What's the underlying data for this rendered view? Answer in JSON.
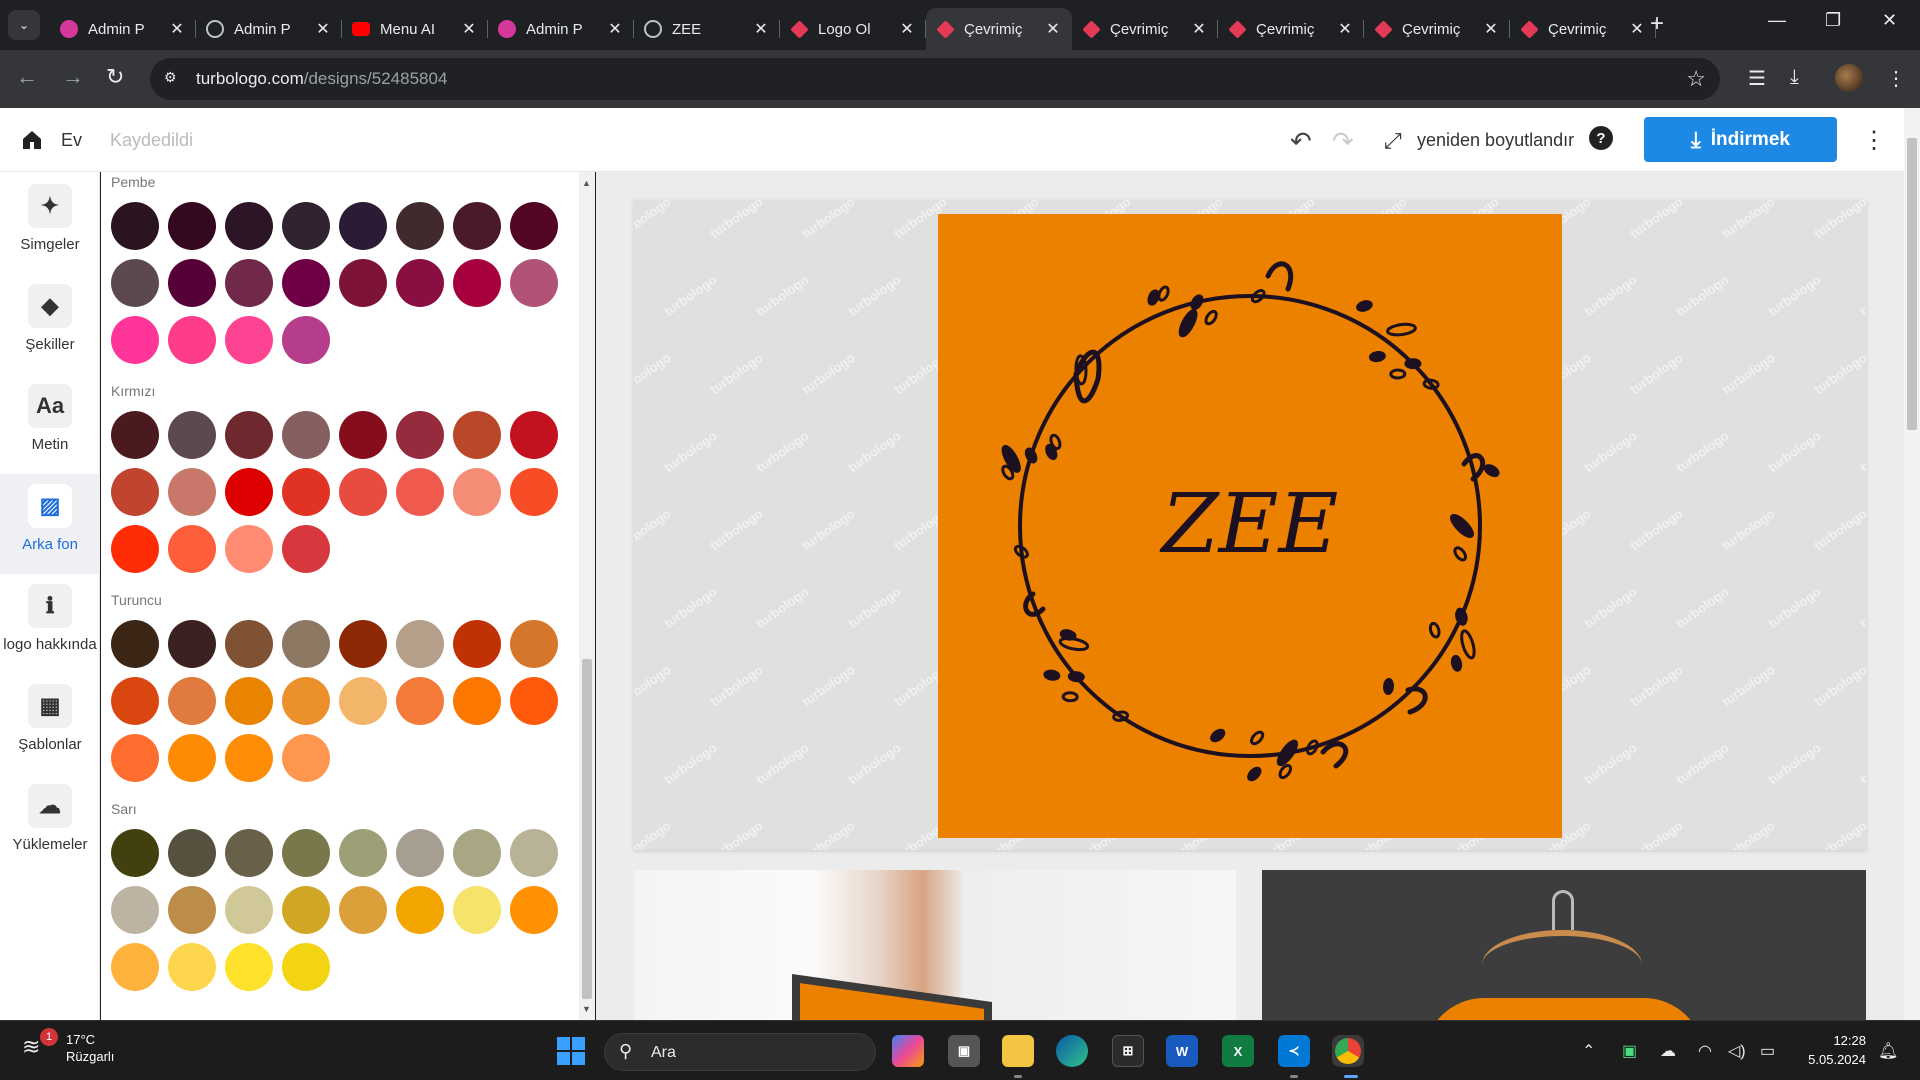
{
  "browser": {
    "tabs": [
      {
        "title": "Admin P",
        "favicon": "admin-icon",
        "active": false
      },
      {
        "title": "Admin P",
        "favicon": "globe-icon",
        "active": false
      },
      {
        "title": "Menu AI",
        "favicon": "youtube-icon",
        "active": false
      },
      {
        "title": "Admin P",
        "favicon": "admin-icon",
        "active": false
      },
      {
        "title": "ZEE",
        "favicon": "globe-icon",
        "active": false
      },
      {
        "title": "Logo Ol",
        "favicon": "turbologo-icon",
        "active": false
      },
      {
        "title": "Çevrimiç",
        "favicon": "turbologo-icon",
        "active": true
      },
      {
        "title": "Çevrimiç",
        "favicon": "turbologo-icon",
        "active": false
      },
      {
        "title": "Çevrimiç",
        "favicon": "turbologo-icon",
        "active": false
      },
      {
        "title": "Çevrimiç",
        "favicon": "turbologo-icon",
        "active": false
      },
      {
        "title": "Çevrimiç",
        "favicon": "turbologo-icon",
        "active": false
      }
    ],
    "url_domain": "turbologo.com",
    "url_path": "/designs/52485804"
  },
  "header": {
    "home_label": "Ev",
    "saved_status": "Kaydedildi",
    "resize_label": "yeniden boyutlandır",
    "download_label": "İndirmek"
  },
  "rail": {
    "items": [
      {
        "label": "Simgeler",
        "icon": "sparkle-icon",
        "active": false
      },
      {
        "label": "Şekiller",
        "icon": "shapes-icon",
        "active": false
      },
      {
        "label": "Metin",
        "icon": "text-icon",
        "active": false
      },
      {
        "label": "Arka fon",
        "icon": "background-icon",
        "active": true
      },
      {
        "label": "logo hakkında",
        "icon": "info-icon",
        "active": false
      },
      {
        "label": "Şablonlar",
        "icon": "templates-icon",
        "active": false
      },
      {
        "label": "Yüklemeler",
        "icon": "upload-cloud-icon",
        "active": false
      }
    ]
  },
  "palette": {
    "groups": [
      {
        "name": "Pembe",
        "colors": [
          "#2a1420",
          "#34081e",
          "#2d1528",
          "#30222f",
          "#2c1b35",
          "#402a2d",
          "#4a1a2b",
          "#520623",
          "#5c4851",
          "#560037",
          "#70294a",
          "#6f0045",
          "#7d1338",
          "#8a0e42",
          "#a7003f",
          "#b15377",
          "#ff3599",
          "#ff3b8b",
          "#ff4393",
          "#b53d8b"
        ]
      },
      {
        "name": "Kırmızı",
        "colors": [
          "#4a1a1e",
          "#5c4850",
          "#6e292e",
          "#865f61",
          "#860d1b",
          "#962b3e",
          "#b84828",
          "#c41120",
          "#c0442f",
          "#c9776a",
          "#dc0000",
          "#e03324",
          "#e84b3f",
          "#f05a4e",
          "#f48c76",
          "#f84c26",
          "#ff2c05",
          "#ff5e3a",
          "#ff8b73",
          "#d7383d"
        ]
      },
      {
        "name": "Turuncu",
        "colors": [
          "#3b2514",
          "#3b2220",
          "#7e5232",
          "#8c7863",
          "#8c2804",
          "#b59e8a",
          "#c03206",
          "#d6762a",
          "#d9460f",
          "#e07b40",
          "#e98300",
          "#ec902b",
          "#f2b56a",
          "#f47a3a",
          "#fc7700",
          "#ff5a0b",
          "#ff6e2e",
          "#ff8a03",
          "#ff8c05",
          "#ff9650"
        ]
      },
      {
        "name": "Sarı",
        "colors": [
          "#42400e",
          "#56503f",
          "#696049",
          "#78784a",
          "#9d9f76",
          "#a79e92",
          "#a8a683",
          "#b8b296",
          "#bcb3a2",
          "#bc8d48",
          "#d1c897",
          "#d0a624",
          "#dca03b",
          "#f2a500",
          "#f6e36b",
          "#ff9103",
          "#fdb33b",
          "#fed64e",
          "#fee12a",
          "#f2d412"
        ]
      }
    ]
  },
  "canvas": {
    "background_color": "#ec8100",
    "logo_text": "ZEE",
    "watermark": "turbologo"
  },
  "taskbar": {
    "weather_temp": "17°C",
    "weather_desc": "Rüzgarlı",
    "weather_badge": "1",
    "search_label": "Ara",
    "time": "12:28",
    "date": "5.05.2024"
  }
}
